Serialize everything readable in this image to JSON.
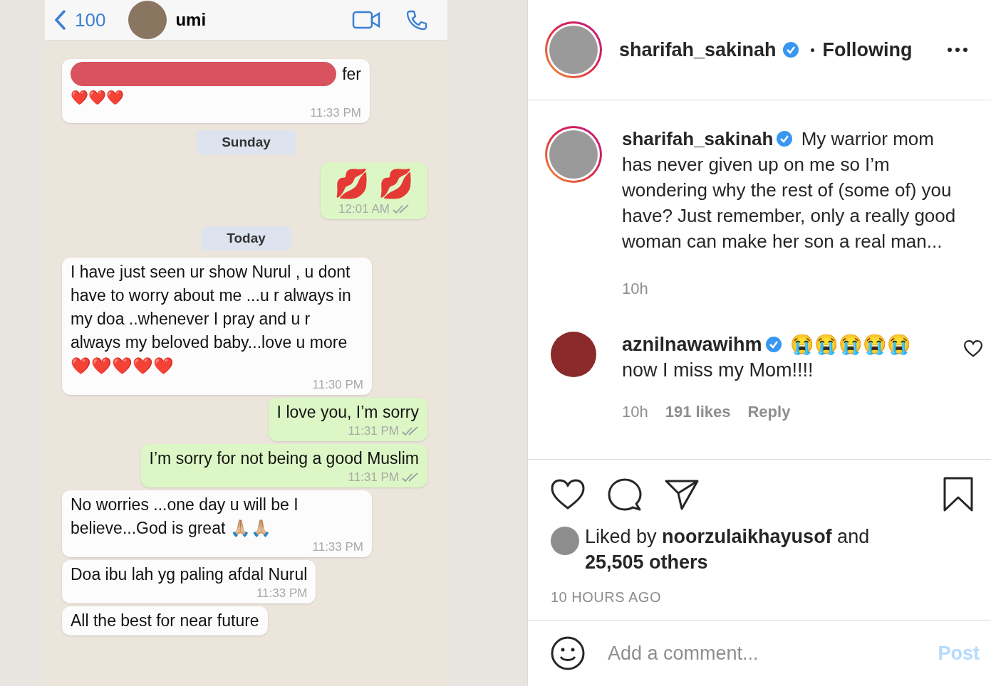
{
  "chat": {
    "back_count": "100",
    "contact": "umi",
    "messages": [
      {
        "kind": "redacted",
        "outgoing": false,
        "text": "fer",
        "hearts": "❤️❤️❤️",
        "time": "11:33 PM"
      },
      {
        "kind": "date",
        "text": "Sunday"
      },
      {
        "kind": "emoji",
        "outgoing": true,
        "text": "💋 💋",
        "time": "12:01 AM"
      },
      {
        "kind": "date",
        "text": "Today"
      },
      {
        "kind": "text",
        "outgoing": false,
        "text": "I have just seen ur show  Nurul , u dont have to worry about me ...u r always in my doa ..whenever I pray and u r always my beloved baby...love u more ❤️❤️❤️❤️❤️",
        "time": "11:30 PM"
      },
      {
        "kind": "text",
        "outgoing": true,
        "text": "I love you, I’m sorry",
        "time": "11:31 PM"
      },
      {
        "kind": "text",
        "outgoing": true,
        "text": "I’m sorry for not being a good Muslim",
        "time": "11:31 PM"
      },
      {
        "kind": "text",
        "outgoing": false,
        "text": "No worries ...one day u will be I believe...God is great 🙏🏼🙏🏼",
        "time": "11:33 PM"
      },
      {
        "kind": "text",
        "outgoing": false,
        "text": "Doa ibu lah yg paling afdal Nurul",
        "time": "11:33 PM"
      },
      {
        "kind": "text",
        "outgoing": false,
        "text": "All the best for near future"
      }
    ]
  },
  "post": {
    "username": "sharifah_sakinah",
    "follow": "Following",
    "caption": {
      "username": "sharifah_sakinah",
      "text": "My warrior mom has never given up on me so I’m wondering why the rest of (some of) you have? Just remember, only a really good woman can make her son a real man...",
      "time": "10h"
    },
    "comments": [
      {
        "username": "aznilnawawihm",
        "text": "😭😭😭😭😭 now I miss my Mom!!!!",
        "time": "10h",
        "likes": "191 likes",
        "reply": "Reply",
        "liked": false
      }
    ],
    "liked_by": "Liked by **noorzulaikhayusof** and **25,505 others**",
    "saved": false,
    "timestamp": "10 HOURS AGO",
    "comment_field": {
      "placeholder": "Add a comment...",
      "post": "Post",
      "disabled": true
    }
  }
}
